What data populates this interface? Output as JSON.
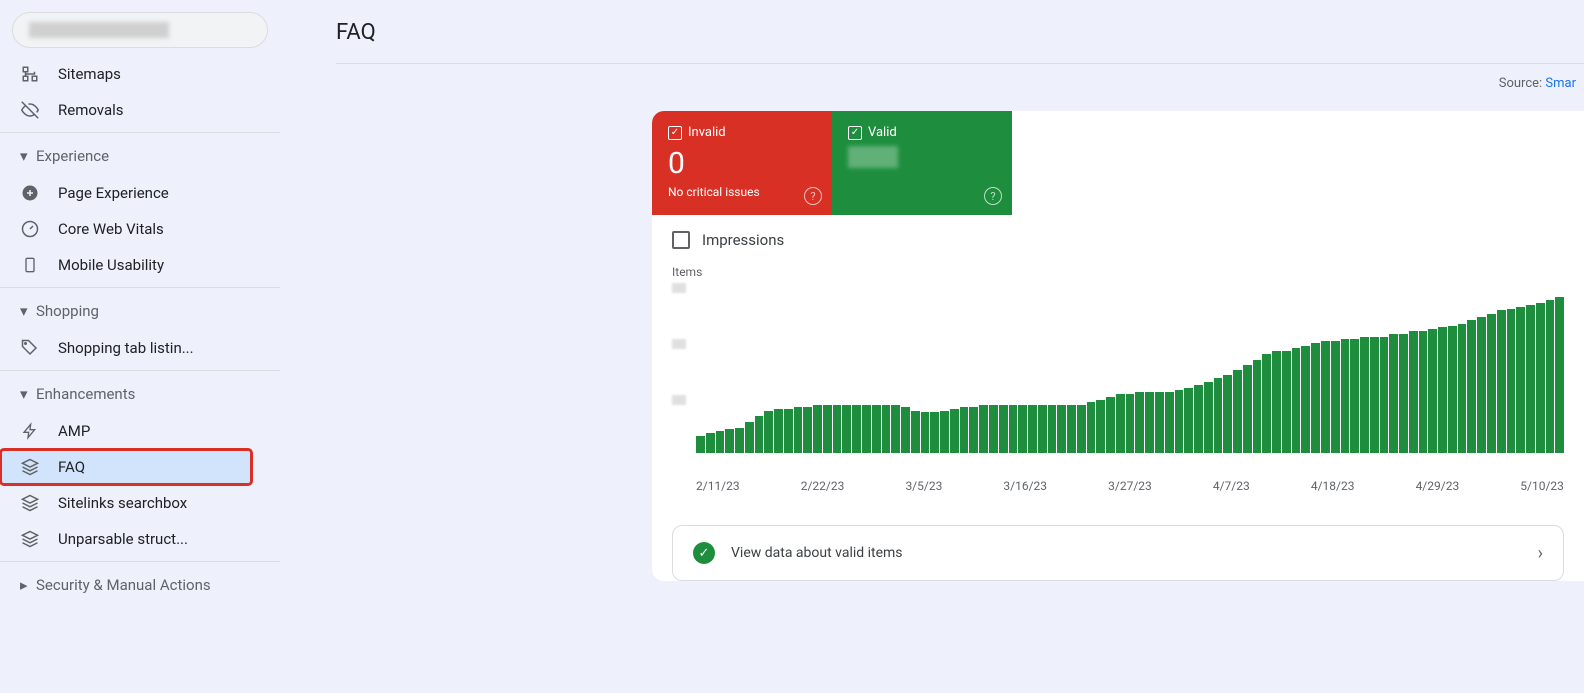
{
  "page_title": "FAQ",
  "source_prefix": "Source: ",
  "source_link": "Smar",
  "sidebar": {
    "items": [
      {
        "label": "Sitemaps",
        "icon": "sitemap"
      },
      {
        "label": "Removals",
        "icon": "removal"
      }
    ],
    "experience_header": "Experience",
    "experience": [
      {
        "label": "Page Experience",
        "icon": "plus-circle"
      },
      {
        "label": "Core Web Vitals",
        "icon": "speed"
      },
      {
        "label": "Mobile Usability",
        "icon": "mobile"
      }
    ],
    "shopping_header": "Shopping",
    "shopping": [
      {
        "label": "Shopping tab listin...",
        "icon": "tag"
      }
    ],
    "enhancements_header": "Enhancements",
    "enhancements": [
      {
        "label": "AMP",
        "icon": "bolt"
      },
      {
        "label": "FAQ",
        "icon": "layers"
      },
      {
        "label": "Sitelinks searchbox",
        "icon": "layers"
      },
      {
        "label": "Unparsable struct...",
        "icon": "layers"
      }
    ],
    "security_header": "Security & Manual Actions"
  },
  "status": {
    "invalid_label": "Invalid",
    "invalid_value": "0",
    "invalid_sub": "No critical issues",
    "valid_label": "Valid"
  },
  "impressions_label": "Impressions",
  "chart_label": "Items",
  "action_text": "View data about valid items",
  "chart_data": {
    "type": "bar",
    "title": "Items",
    "xlabel": "",
    "ylabel": "Items",
    "ylim": [
      0,
      100
    ],
    "categories": [
      "2/11/23",
      "2/22/23",
      "3/5/23",
      "3/16/23",
      "3/27/23",
      "4/7/23",
      "4/18/23",
      "4/29/23",
      "5/10/23"
    ],
    "values": [
      10,
      12,
      13,
      14,
      15,
      18,
      22,
      25,
      26,
      26,
      27,
      27,
      28,
      28,
      28,
      28,
      28,
      28,
      28,
      28,
      28,
      27,
      25,
      24,
      24,
      25,
      26,
      27,
      27,
      28,
      28,
      28,
      28,
      28,
      28,
      28,
      28,
      28,
      28,
      28,
      30,
      31,
      33,
      35,
      35,
      36,
      36,
      36,
      36,
      37,
      38,
      40,
      42,
      44,
      46,
      49,
      52,
      55,
      58,
      60,
      60,
      62,
      63,
      65,
      66,
      66,
      67,
      67,
      68,
      68,
      68,
      70,
      70,
      72,
      72,
      73,
      74,
      75,
      76,
      78,
      80,
      82,
      84,
      85,
      86,
      87,
      88,
      90,
      92
    ]
  }
}
